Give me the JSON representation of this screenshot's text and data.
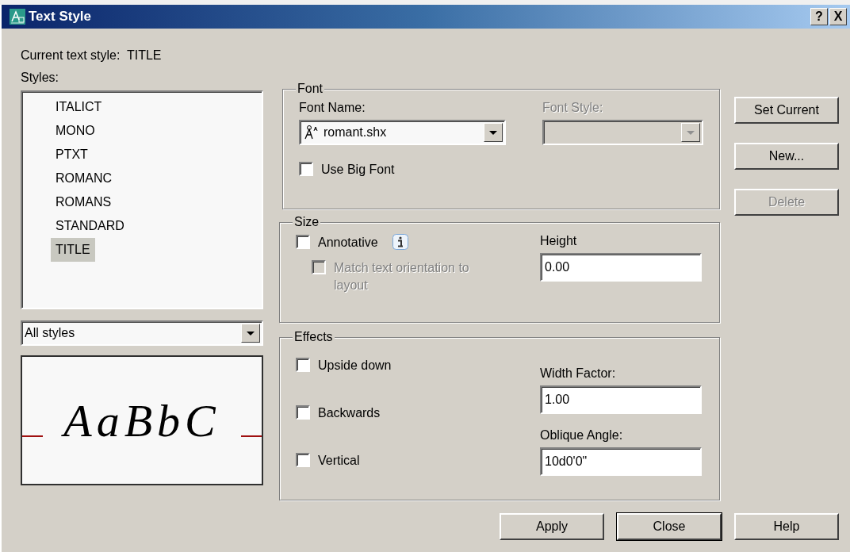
{
  "window": {
    "title": "Text Style",
    "title_buttons": [
      "?",
      "X"
    ]
  },
  "current_style": {
    "label": "Current text style:",
    "value": "TITLE"
  },
  "styles": {
    "label": "Styles:",
    "items": [
      {
        "name": "ITALICT",
        "selected": false
      },
      {
        "name": "MONO",
        "selected": false
      },
      {
        "name": "PTXT",
        "selected": false
      },
      {
        "name": "ROMANC",
        "selected": false
      },
      {
        "name": "ROMANS",
        "selected": false
      },
      {
        "name": "STANDARD",
        "selected": false
      },
      {
        "name": "TITLE",
        "selected": true
      }
    ]
  },
  "filter": {
    "value": "All styles"
  },
  "preview": {
    "text": "AaBbC"
  },
  "font": {
    "title": "Font",
    "font_name": {
      "label": "Font Name:",
      "value": "romant.shx",
      "disabled": false
    },
    "font_style": {
      "label": "Font Style:",
      "disabled": true
    },
    "use_big_font": {
      "label": "Use Big Font",
      "checked": false,
      "disabled": false
    }
  },
  "size": {
    "title": "Size",
    "annotative": {
      "label": "Annotative",
      "checked": false,
      "disabled": false
    },
    "match_orientation": {
      "label": "Match text orientation to layout",
      "checked": false,
      "disabled": true
    },
    "height": {
      "label": "Height",
      "value": "0.00"
    }
  },
  "effects": {
    "title": "Effects",
    "checkboxes": [
      {
        "label": "Upside down",
        "checked": false,
        "disabled": false
      },
      {
        "label": "Backwards",
        "checked": false,
        "disabled": false
      },
      {
        "label": "Vertical",
        "checked": false,
        "disabled": false
      }
    ],
    "width_factor": {
      "label": "Width Factor:",
      "value": "1.00"
    },
    "oblique_angle": {
      "label": "Oblique Angle:",
      "value": "10d0'0\""
    }
  },
  "side_buttons": [
    {
      "label": "Set Current",
      "disabled": false
    },
    {
      "label": "New...",
      "disabled": false
    },
    {
      "label": "Delete",
      "disabled": true
    }
  ],
  "footer_buttons": [
    {
      "label": "Apply",
      "default": false
    },
    {
      "label": "Close",
      "default": true
    },
    {
      "label": "Help",
      "default": false
    }
  ]
}
